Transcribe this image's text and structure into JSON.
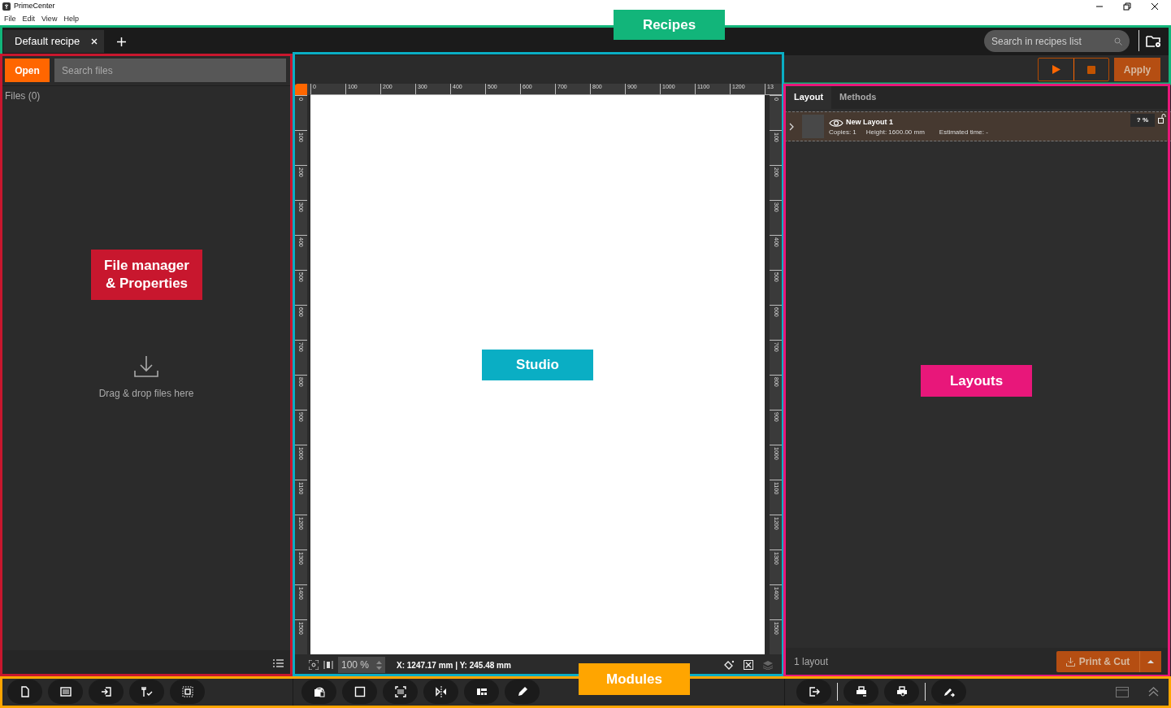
{
  "window": {
    "title": "PrimeCenter"
  },
  "menu": [
    "File",
    "Edit",
    "View",
    "Help"
  ],
  "recipe_tabs": [
    {
      "label": "Default recipe",
      "selected": true
    }
  ],
  "recipes_search": {
    "placeholder": "Search in recipes list"
  },
  "apply_button": "Apply",
  "file_manager": {
    "open_button": "Open",
    "search": {
      "placeholder": "Search files"
    },
    "files_count": "Files (0)",
    "drop_hint": "Drag & drop files here"
  },
  "studio": {
    "top_ruler": [
      "0",
      "100",
      "200",
      "300",
      "400",
      "500",
      "600",
      "700",
      "800",
      "900",
      "1000",
      "1100",
      "1200",
      "13"
    ],
    "left_ruler": [
      "0",
      "100",
      "200",
      "300",
      "400",
      "500",
      "600",
      "700",
      "800",
      "900",
      "1000",
      "1100",
      "1200",
      "1300",
      "1400",
      "1500"
    ],
    "right_ruler": [
      "0",
      "100",
      "200",
      "300",
      "400",
      "500",
      "600",
      "700",
      "800",
      "900",
      "1000",
      "1100",
      "1200",
      "1300",
      "1400",
      "1500"
    ],
    "zoom": "100 %",
    "coordinates": "X: 1247.17 mm | Y: 245.48 mm"
  },
  "layouts_panel": {
    "tabs": [
      {
        "label": "Layout",
        "selected": true
      },
      {
        "label": "Methods",
        "selected": false
      }
    ],
    "items": [
      {
        "name": "New Layout 1",
        "expanded": false,
        "copies": "Copies: 1",
        "height": "Height: 1600.00 mm",
        "estimated": "Estimated time: -",
        "percent": "? %"
      }
    ],
    "count": "1 layout",
    "print_button": "Print & Cut"
  },
  "annotations": [
    {
      "label": "Recipes",
      "color": "#12b57a"
    },
    {
      "label": "File manager & Properties",
      "color": "#c8172e"
    },
    {
      "label": "Studio",
      "color": "#0aaec4"
    },
    {
      "label": "Layouts",
      "color": "#e8177a"
    },
    {
      "label": "Modules",
      "color": "#ffa500"
    }
  ]
}
